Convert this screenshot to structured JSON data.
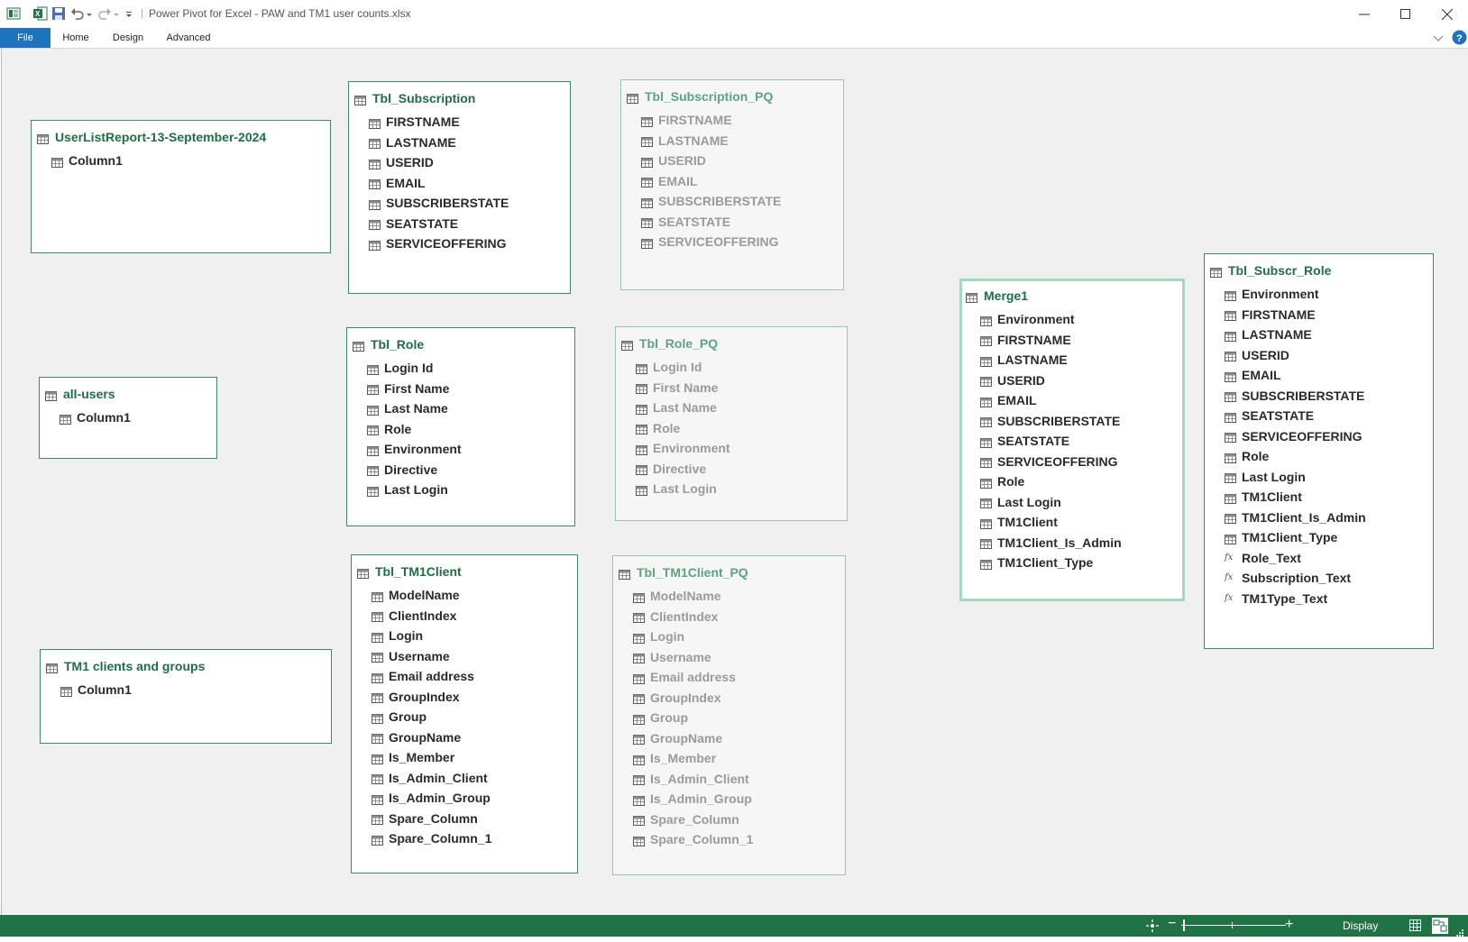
{
  "window": {
    "title": "Power Pivot for Excel - PAW and TM1 user counts.xlsx",
    "separator": "|"
  },
  "ribbon": {
    "tabs": [
      {
        "label": "File",
        "active": true
      },
      {
        "label": "Home",
        "active": false
      },
      {
        "label": "Design",
        "active": false
      },
      {
        "label": "Advanced",
        "active": false
      }
    ]
  },
  "colors": {
    "accent": "#1e73be",
    "table_title": "#1f6f45",
    "status_bar": "#217346",
    "selected_border": "#a6d8bd"
  },
  "tables": {
    "userlist": {
      "name": "UserListReport-13-September-2024",
      "columns": [
        "Column1"
      ]
    },
    "all_users": {
      "name": "all-users",
      "columns": [
        "Column1"
      ]
    },
    "tm1_clients_groups": {
      "name": "TM1 clients and groups",
      "columns": [
        "Column1"
      ]
    },
    "tbl_subscription": {
      "name": "Tbl_Subscription",
      "columns": [
        "FIRSTNAME",
        "LASTNAME",
        "USERID",
        "EMAIL",
        "SUBSCRIBERSTATE",
        "SEATSTATE",
        "SERVICEOFFERING"
      ]
    },
    "tbl_subscription_pq": {
      "name": "Tbl_Subscription_PQ",
      "columns": [
        "FIRSTNAME",
        "LASTNAME",
        "USERID",
        "EMAIL",
        "SUBSCRIBERSTATE",
        "SEATSTATE",
        "SERVICEOFFERING"
      ]
    },
    "tbl_role": {
      "name": "Tbl_Role",
      "columns": [
        "Login Id",
        "First Name",
        "Last Name",
        "Role",
        "Environment",
        "Directive",
        "Last Login"
      ]
    },
    "tbl_role_pq": {
      "name": "Tbl_Role_PQ",
      "columns": [
        "Login Id",
        "First Name",
        "Last Name",
        "Role",
        "Environment",
        "Directive",
        "Last Login"
      ]
    },
    "tbl_tm1client": {
      "name": "Tbl_TM1Client",
      "columns": [
        "ModelName",
        "ClientIndex",
        "Login",
        "Username",
        "Email address",
        "GroupIndex",
        "Group",
        "GroupName",
        "Is_Member",
        "Is_Admin_Client",
        "Is_Admin_Group",
        "Spare_Column",
        "Spare_Column_1"
      ]
    },
    "tbl_tm1client_pq": {
      "name": "Tbl_TM1Client_PQ",
      "columns": [
        "ModelName",
        "ClientIndex",
        "Login",
        "Username",
        "Email address",
        "GroupIndex",
        "Group",
        "GroupName",
        "Is_Member",
        "Is_Admin_Client",
        "Is_Admin_Group",
        "Spare_Column",
        "Spare_Column_1"
      ]
    },
    "merge1": {
      "name": "Merge1",
      "columns": [
        "Environment",
        "FIRSTNAME",
        "LASTNAME",
        "USERID",
        "EMAIL",
        "SUBSCRIBERSTATE",
        "SEATSTATE",
        "SERVICEOFFERING",
        "Role",
        "Last Login",
        "TM1Client",
        "TM1Client_Is_Admin",
        "TM1Client_Type"
      ]
    },
    "tbl_subscr_role": {
      "name": "Tbl_Subscr_Role",
      "columns": [
        "Environment",
        "FIRSTNAME",
        "LASTNAME",
        "USERID",
        "EMAIL",
        "SUBSCRIBERSTATE",
        "SEATSTATE",
        "SERVICEOFFERING",
        "Role",
        "Last Login",
        "TM1Client",
        "TM1Client_Is_Admin",
        "TM1Client_Type",
        "Role_Text",
        "Subscription_Text",
        "TM1Type_Text"
      ]
    }
  },
  "statusbar": {
    "display_label": "Display",
    "zoom_minus": "−",
    "zoom_plus": "+"
  }
}
